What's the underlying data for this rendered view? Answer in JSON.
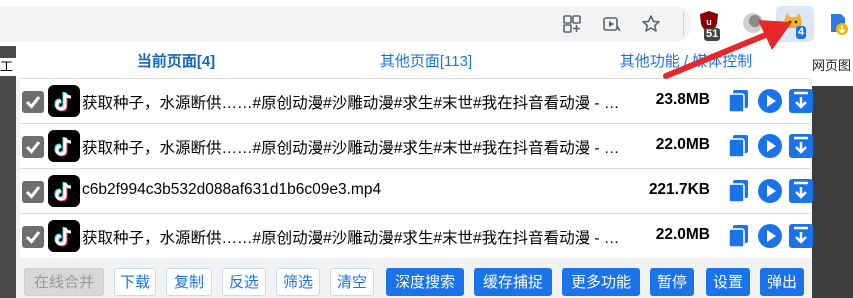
{
  "toolbar": {
    "extension_badge_count": "51",
    "active_extension_badge": "4",
    "icons": [
      "app-grid-icon",
      "media-play-icon",
      "star-icon",
      "shield-extension-icon",
      "ghost-extension-icon",
      "cat-downloader-icon",
      "download-icon"
    ]
  },
  "page_edge": {
    "left_text": "工",
    "right_text": "网页图"
  },
  "tabs": [
    {
      "label": "当前页面[4]",
      "active": true
    },
    {
      "label": "其他页面[113]",
      "active": false
    },
    {
      "label": "其他功能 / 媒体控制",
      "active": false
    }
  ],
  "rows": [
    {
      "checked": true,
      "title": "获取种子，水源断供……#原创动漫#沙雕动漫#求生#末世#我在抖音看动漫 - …",
      "size": "23.8MB"
    },
    {
      "checked": true,
      "title": "获取种子，水源断供……#原创动漫#沙雕动漫#求生#末世#我在抖音看动漫 - …",
      "size": "22.0MB"
    },
    {
      "checked": true,
      "title": "c6b2f994c3b532d088af631d1b6c09e3.mp4",
      "size": "221.7KB"
    },
    {
      "checked": true,
      "title": "获取种子，水源断供……#原创动漫#沙雕动漫#求生#末世#我在抖音看动漫 - …",
      "size": "22.0MB"
    }
  ],
  "buttons": [
    {
      "label": "在线合并",
      "style": "disabled"
    },
    {
      "label": "下载",
      "style": "outline"
    },
    {
      "label": "复制",
      "style": "outline"
    },
    {
      "label": "反选",
      "style": "outline"
    },
    {
      "label": "筛选",
      "style": "outline"
    },
    {
      "label": "清空",
      "style": "outline"
    },
    {
      "label": "深度搜索",
      "style": "solid"
    },
    {
      "label": "缓存捕捉",
      "style": "solid"
    },
    {
      "label": "更多功能",
      "style": "solid"
    },
    {
      "label": "暂停",
      "style": "solid"
    },
    {
      "label": "设置",
      "style": "solid"
    },
    {
      "label": "弹出",
      "style": "solid"
    }
  ],
  "colors": {
    "accent": "#1a73e8",
    "arrow": "#e8272a",
    "checkbox": "#6e6e6e"
  }
}
